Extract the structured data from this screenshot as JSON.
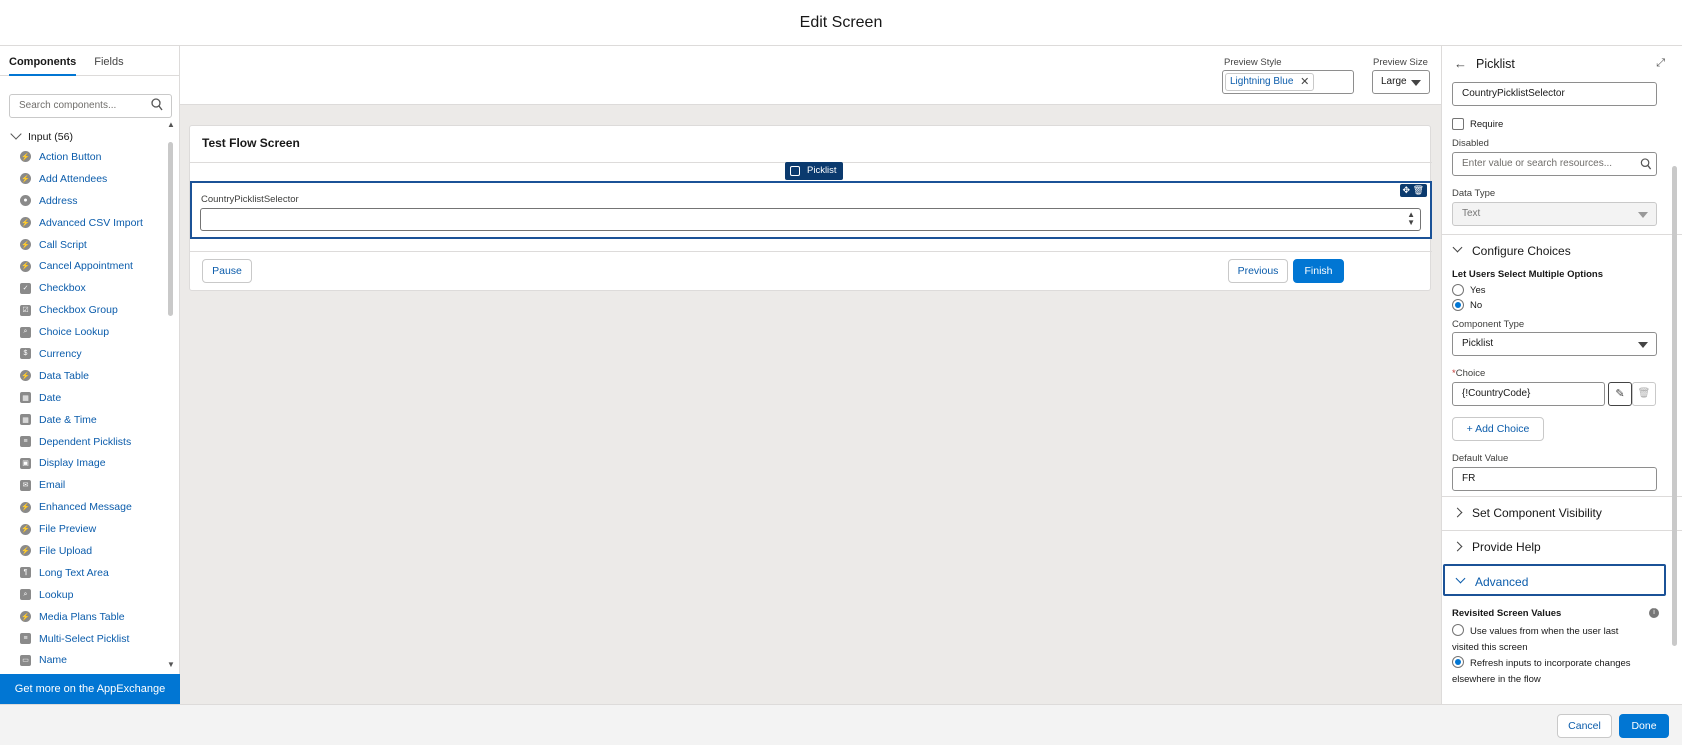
{
  "header": {
    "title": "Edit Screen"
  },
  "left_panel": {
    "tabs": [
      {
        "label": "Components"
      },
      {
        "label": "Fields"
      }
    ],
    "search_placeholder": "Search components...",
    "group_label": "Input (56)",
    "items": [
      {
        "label": "Action Button",
        "icon": "bolt-icon"
      },
      {
        "label": "Add Attendees",
        "icon": "bolt-icon"
      },
      {
        "label": "Address",
        "icon": "location-icon"
      },
      {
        "label": "Advanced CSV Import",
        "icon": "bolt-icon"
      },
      {
        "label": "Call Script",
        "icon": "bolt-icon"
      },
      {
        "label": "Cancel Appointment",
        "icon": "bolt-icon"
      },
      {
        "label": "Checkbox",
        "icon": "check-icon"
      },
      {
        "label": "Checkbox Group",
        "icon": "checkbox-group-icon"
      },
      {
        "label": "Choice Lookup",
        "icon": "lookup-icon"
      },
      {
        "label": "Currency",
        "icon": "currency-icon"
      },
      {
        "label": "Data Table",
        "icon": "bolt-icon"
      },
      {
        "label": "Date",
        "icon": "calendar-icon"
      },
      {
        "label": "Date & Time",
        "icon": "calendar-icon"
      },
      {
        "label": "Dependent Picklists",
        "icon": "list-icon"
      },
      {
        "label": "Display Image",
        "icon": "image-icon"
      },
      {
        "label": "Email",
        "icon": "email-icon"
      },
      {
        "label": "Enhanced Message",
        "icon": "bolt-icon"
      },
      {
        "label": "File Preview",
        "icon": "bolt-icon"
      },
      {
        "label": "File Upload",
        "icon": "bolt-icon"
      },
      {
        "label": "Long Text Area",
        "icon": "text-area-icon"
      },
      {
        "label": "Lookup",
        "icon": "lookup-icon"
      },
      {
        "label": "Media Plans Table",
        "icon": "bolt-icon"
      },
      {
        "label": "Multi-Select Picklist",
        "icon": "multi-picklist-icon"
      },
      {
        "label": "Name",
        "icon": "name-icon"
      }
    ],
    "appexchange_label": "Get more on the AppExchange"
  },
  "toolbar": {
    "preview_style_label": "Preview Style",
    "preview_style_value": "Lightning Blue",
    "preview_size_label": "Preview Size",
    "preview_size_value": "Large"
  },
  "canvas": {
    "screen_title": "Test Flow Screen",
    "badge_label": "Picklist",
    "field_label": "CountryPicklistSelector",
    "pause_label": "Pause",
    "previous_label": "Previous",
    "finish_label": "Finish"
  },
  "properties": {
    "title": "Picklist",
    "api_name_value": "CountryPicklistSelector",
    "require_label": "Require",
    "disabled_label": "Disabled",
    "disabled_placeholder": "Enter value or search resources...",
    "data_type_label": "Data Type",
    "data_type_value": "Text",
    "configure_choices_label": "Configure Choices",
    "multi_select_label": "Let Users Select Multiple Options",
    "yes_label": "Yes",
    "no_label": "No",
    "component_type_label": "Component Type",
    "component_type_value": "Picklist",
    "choice_required_mark": "*",
    "choice_label": "Choice",
    "choice_value": "{!CountryCode}",
    "add_choice_label": "Add Choice",
    "default_value_label": "Default Value",
    "default_value": "FR",
    "visibility_label": "Set Component Visibility",
    "help_label": "Provide Help",
    "advanced_label": "Advanced",
    "revisited_label": "Revisited Screen Values",
    "revisited_option1": "Use values from when the user last visited this screen",
    "revisited_option2": "Refresh inputs to incorporate changes elsewhere in the flow"
  },
  "footer": {
    "cancel_label": "Cancel",
    "done_label": "Done"
  },
  "colors": {
    "brand": "#0176d3",
    "link": "#0b5cab",
    "badge": "#0b3a6e",
    "canvas_bg": "#eceae8"
  }
}
